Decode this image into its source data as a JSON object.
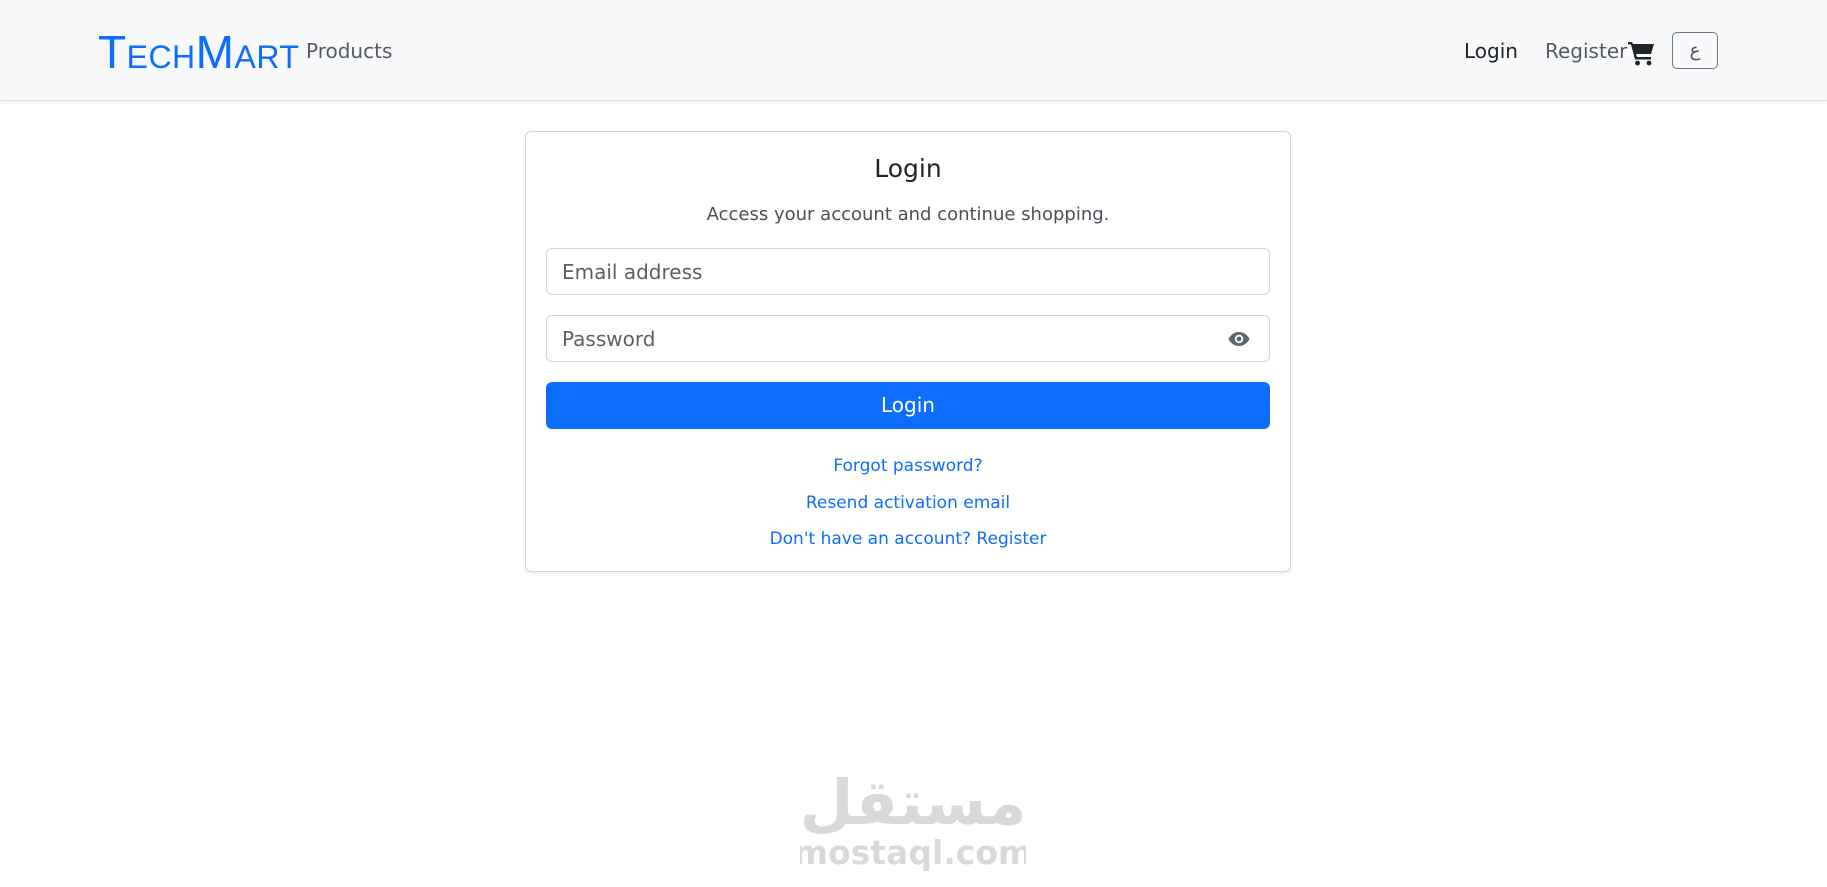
{
  "brand": {
    "name": "TechMart"
  },
  "nav": {
    "products": "Products",
    "login": "Login",
    "register": "Register",
    "cart_icon": "shopping-cart-icon",
    "language_toggle": "ع"
  },
  "login_card": {
    "title": "Login",
    "subtitle": "Access your account and continue shopping.",
    "email_placeholder": "Email address",
    "password_placeholder": "Password",
    "password_toggle_icon": "eye-icon",
    "submit_label": "Login",
    "forgot_password": "Forgot password?",
    "resend_activation": "Resend activation email",
    "register_prompt": "Don't have an account? Register"
  },
  "watermark": {
    "arabic_text": "مستقل",
    "domain": "mostaql.com"
  },
  "colors": {
    "accent": "#0d6efd",
    "navbar_bg": "#f8f9fa",
    "watermark": "#d9d9d9"
  }
}
